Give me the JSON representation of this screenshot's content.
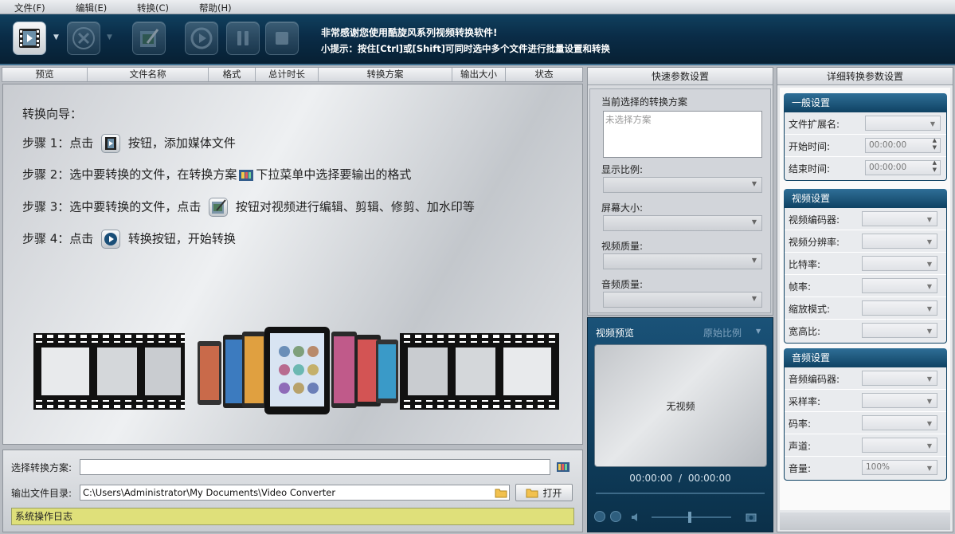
{
  "menu": {
    "file": "文件(F)",
    "edit": "编辑(E)",
    "convert": "转换(C)",
    "help": "帮助(H)"
  },
  "toolbar": {
    "message_line1": "非常感谢您使用酷旋风系列视频转换软件!",
    "message_line2": "小提示：按住[Ctrl]或[Shift]可同时选中多个文件进行批量设置和转换"
  },
  "file_list": {
    "columns": [
      "预览",
      "文件名称",
      "格式",
      "总计时长",
      "转换方案",
      "输出大小",
      "状态"
    ]
  },
  "wizard": {
    "title": "转换向导：",
    "step1_pre": "步骤 1：点击",
    "step1_post": "按钮，添加媒体文件",
    "step2_pre": "步骤 2：选中要转换的文件，在转换方案",
    "step2_post": "下拉菜单中选择要输出的格式",
    "step3_pre": "步骤 3：选中要转换的文件，点击",
    "step3_post": "按钮对视频进行编辑、剪辑、修剪、加水印等",
    "step4_pre": "步骤 4：点击",
    "step4_post": "转换按钮，开始转换"
  },
  "bottom": {
    "scheme_label": "选择转换方案:",
    "scheme_value": "",
    "output_label": "输出文件目录:",
    "output_value": "C:\\Users\\Administrator\\My Documents\\Video Converter",
    "open_label": "打开",
    "log_label": "系统操作日志"
  },
  "quick_params": {
    "title": "快速参数设置",
    "current_scheme_label": "当前选择的转换方案",
    "current_scheme_placeholder": "未选择方案",
    "aspect_label": "显示比例:",
    "screen_label": "屏幕大小:",
    "video_quality_label": "视频质量:",
    "audio_quality_label": "音频质量:"
  },
  "preview": {
    "title": "视频预览",
    "ratio": "原始比例",
    "no_video": "无视频",
    "time_current": "00:00:00",
    "time_separator": "/",
    "time_total": "00:00:00"
  },
  "detail_params": {
    "title": "详细转换参数设置",
    "general": {
      "heading": "一般设置",
      "ext_label": "文件扩展名:",
      "ext_value": "",
      "start_label": "开始时间:",
      "start_value": "00:00:00",
      "end_label": "结束时间:",
      "end_value": "00:00:00"
    },
    "video": {
      "heading": "视频设置",
      "codec_label": "视频编码器:",
      "resolution_label": "视频分辨率:",
      "bitrate_label": "比特率:",
      "framerate_label": "帧率:",
      "scale_label": "缩放模式:",
      "aspect_label": "宽高比:"
    },
    "audio": {
      "heading": "音频设置",
      "codec_label": "音频编码器:",
      "samplerate_label": "采样率:",
      "bitrate_label": "码率:",
      "channels_label": "声道:",
      "volume_label": "音量:",
      "volume_value": "100%"
    }
  },
  "colors": {
    "toolbar_bg": "#0a2c47",
    "log_bar": "#dfe07a",
    "group_head": "#0f4263"
  }
}
